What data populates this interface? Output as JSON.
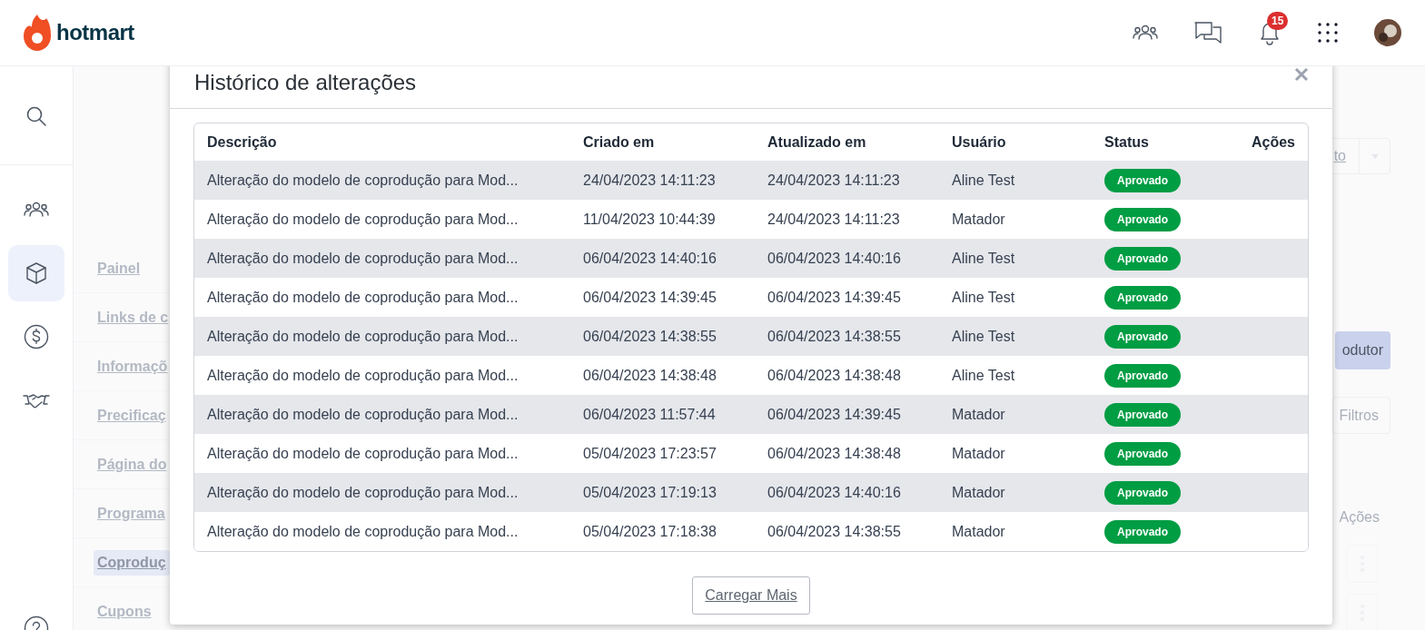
{
  "header": {
    "logo_text": "hotmart",
    "notification_count": "15"
  },
  "sidebar": {
    "items": [
      {
        "kind": "search",
        "selected": false
      },
      {
        "kind": "people",
        "selected": false
      },
      {
        "kind": "product",
        "selected": true
      },
      {
        "kind": "money",
        "selected": false
      },
      {
        "kind": "handshake",
        "selected": false
      }
    ]
  },
  "background": {
    "nav_items": [
      {
        "label": "Painel",
        "selected": false
      },
      {
        "label": "Links de c",
        "selected": false
      },
      {
        "label": "Informaçõ",
        "selected": false
      },
      {
        "label": "Precificaç",
        "selected": false
      },
      {
        "label": "Página do",
        "selected": false
      },
      {
        "label": "Programa",
        "selected": false
      },
      {
        "label": "Coproduç",
        "selected": true
      },
      {
        "label": "Cupons",
        "selected": false
      }
    ],
    "top_button": "to",
    "primary_button": "odutor",
    "filter_button": "Filtros",
    "actions_header": "Ações"
  },
  "modal": {
    "title": "Histórico de alterações",
    "columns": [
      "Descrição",
      "Criado em",
      "Atualizado em",
      "Usuário",
      "Status",
      "Ações"
    ],
    "rows": [
      {
        "description": "Alteração do modelo de coprodução para Mod...",
        "created": "24/04/2023 14:11:23",
        "updated": "24/04/2023 14:11:23",
        "user": "Aline Test",
        "status": "Aprovado"
      },
      {
        "description": "Alteração do modelo de coprodução para Mod...",
        "created": "11/04/2023 10:44:39",
        "updated": "24/04/2023 14:11:23",
        "user": "Matador",
        "status": "Aprovado"
      },
      {
        "description": "Alteração do modelo de coprodução para Mod...",
        "created": "06/04/2023 14:40:16",
        "updated": "06/04/2023 14:40:16",
        "user": "Aline Test",
        "status": "Aprovado"
      },
      {
        "description": "Alteração do modelo de coprodução para Mod...",
        "created": "06/04/2023 14:39:45",
        "updated": "06/04/2023 14:39:45",
        "user": "Aline Test",
        "status": "Aprovado"
      },
      {
        "description": "Alteração do modelo de coprodução para Mod...",
        "created": "06/04/2023 14:38:55",
        "updated": "06/04/2023 14:38:55",
        "user": "Aline Test",
        "status": "Aprovado"
      },
      {
        "description": "Alteração do modelo de coprodução para Mod...",
        "created": "06/04/2023 14:38:48",
        "updated": "06/04/2023 14:38:48",
        "user": "Aline Test",
        "status": "Aprovado"
      },
      {
        "description": "Alteração do modelo de coprodução para Mod...",
        "created": "06/04/2023 11:57:44",
        "updated": "06/04/2023 14:39:45",
        "user": "Matador",
        "status": "Aprovado"
      },
      {
        "description": "Alteração do modelo de coprodução para Mod...",
        "created": "05/04/2023 17:23:57",
        "updated": "06/04/2023 14:38:48",
        "user": "Matador",
        "status": "Aprovado"
      },
      {
        "description": "Alteração do modelo de coprodução para Mod...",
        "created": "05/04/2023 17:19:13",
        "updated": "06/04/2023 14:40:16",
        "user": "Matador",
        "status": "Aprovado"
      },
      {
        "description": "Alteração do modelo de coprodução para Mod...",
        "created": "05/04/2023 17:18:38",
        "updated": "06/04/2023 14:38:55",
        "user": "Matador",
        "status": "Aprovado"
      }
    ],
    "load_more": "Carregar Mais"
  }
}
